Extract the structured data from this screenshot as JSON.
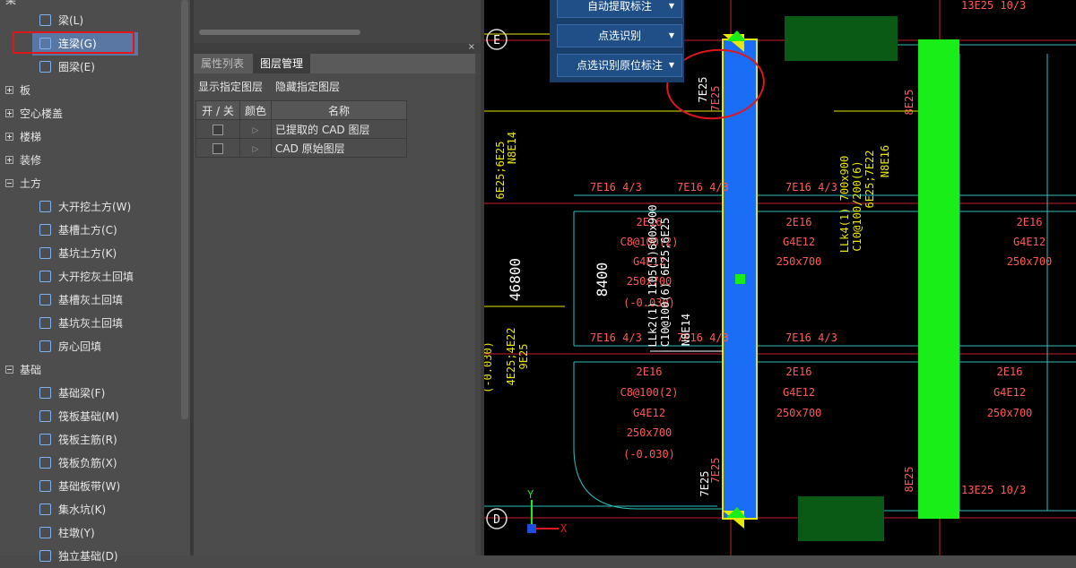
{
  "tree": {
    "top_cut": "梁",
    "items": [
      {
        "label": "梁(L)",
        "indent": "child"
      },
      {
        "label": "连梁(G)",
        "indent": "child",
        "selected": true
      },
      {
        "label": "圈梁(E)",
        "indent": "child"
      },
      {
        "label": "板",
        "indent": "cat",
        "state": "collapsed"
      },
      {
        "label": "空心楼盖",
        "indent": "cat",
        "state": "collapsed"
      },
      {
        "label": "楼梯",
        "indent": "cat",
        "state": "collapsed"
      },
      {
        "label": "装修",
        "indent": "cat",
        "state": "collapsed"
      },
      {
        "label": "土方",
        "indent": "cat",
        "state": "expanded"
      },
      {
        "label": "大开挖土方(W)",
        "indent": "child"
      },
      {
        "label": "基槽土方(C)",
        "indent": "child"
      },
      {
        "label": "基坑土方(K)",
        "indent": "child"
      },
      {
        "label": "大开挖灰土回填",
        "indent": "child"
      },
      {
        "label": "基槽灰土回填",
        "indent": "child"
      },
      {
        "label": "基坑灰土回填",
        "indent": "child"
      },
      {
        "label": "房心回填",
        "indent": "child"
      },
      {
        "label": "基础",
        "indent": "cat",
        "state": "expanded"
      },
      {
        "label": "基础梁(F)",
        "indent": "child"
      },
      {
        "label": "筏板基础(M)",
        "indent": "child"
      },
      {
        "label": "筏板主筋(R)",
        "indent": "child"
      },
      {
        "label": "筏板负筋(X)",
        "indent": "child"
      },
      {
        "label": "基础板带(W)",
        "indent": "child"
      },
      {
        "label": "集水坑(K)",
        "indent": "child"
      },
      {
        "label": "柱墩(Y)",
        "indent": "child"
      },
      {
        "label": "独立基础(D)",
        "indent": "child"
      }
    ]
  },
  "layer_panel": {
    "tabs": [
      "属性列表",
      "图层管理"
    ],
    "active_tab": "图层管理",
    "close": "×",
    "actions": [
      "显示指定图层",
      "隐藏指定图层"
    ],
    "columns": [
      "开 / 关",
      "颜色",
      "名称"
    ],
    "rows": [
      {
        "name": "已提取的 CAD 图层"
      },
      {
        "name": "CAD 原始图层"
      }
    ]
  },
  "toolbar": {
    "buttons": [
      "自动提取标注",
      "点选识别",
      "点选识别原位标注"
    ]
  },
  "cad": {
    "axis_labels": [
      "E",
      "D"
    ],
    "dims": [
      "46800",
      "8400"
    ],
    "ucs": {
      "y": "Y",
      "x": "X"
    },
    "texts": [
      "7E25",
      "7E25",
      "7E25",
      "7E25",
      "13E25 10/3",
      "13E25 10/3",
      "8E25",
      "8E25",
      "N8E14",
      "6E25;6E25",
      "7E16 4/3",
      "7E16 4/3",
      "7E16 4/3",
      "7E16 4/3",
      "7E16 4/3",
      "7E16 4/3",
      "2E16",
      "C8@100(2)",
      "G4E12",
      "250x700",
      "(-0.030)",
      "2E16",
      "G4E12",
      "250x700",
      "2E16",
      "G4E12",
      "250x700",
      "2E16",
      "C8@100(2)",
      "G4E12",
      "250x700",
      "(-0.030)",
      "2E16",
      "G4E12",
      "250x700",
      "2E16",
      "G4E12",
      "250x700",
      "LLk4(1) 700x900",
      "C10@100/200(6)",
      "6E25;7E22",
      "N8E16",
      "LLk2(1) 1105(5)600x900",
      "C10@100(6) 6E25;6E25",
      "N8E14",
      "N6E14",
      "(-0.030)",
      "4E25;4E22",
      "9E25"
    ]
  },
  "colors": {
    "selection_box": "#e0161d",
    "beam_blue": "#1a6ef5",
    "beam_green": "#19ee19",
    "cad_bg": "#000000",
    "cad_red": "#ff3a3a",
    "cad_yellow": "#e8e800",
    "cad_cyan": "#30c0c0",
    "dark_green": "#0a5a16"
  }
}
